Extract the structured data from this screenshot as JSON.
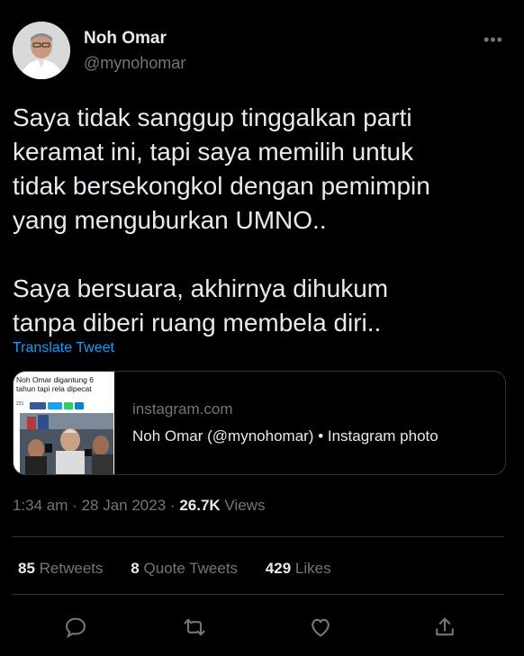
{
  "author": {
    "name": "Noh Omar",
    "handle": "@mynohomar"
  },
  "more_icon": "more-horizontal-icon",
  "tweet": {
    "text": "Saya tidak sanggup tinggalkan parti\nkeramat ini, tapi saya memilih untuk\ntidak bersekongkol dengan pemimpin\nyang menguburkan UMNO..\n\nSaya bersuara, akhirnya dihukum\ntanpa diberi ruang membela diri..",
    "translate_label": "Translate Tweet"
  },
  "link_card": {
    "thumb_headline": "Noh Omar digantung 6 tahun tapi rela dipecat",
    "thumb_count": "221",
    "domain": "instagram.com",
    "title": "Noh Omar (@mynohomar) • Instagram photo"
  },
  "meta": {
    "time": "1:34 am",
    "separator": "·",
    "date": "28 Jan 2023",
    "views_count": "26.7K",
    "views_label": "Views"
  },
  "stats": {
    "retweets_count": "85",
    "retweets_label": "Retweets",
    "quotes_count": "8",
    "quotes_label": "Quote Tweets",
    "likes_count": "429",
    "likes_label": "Likes"
  },
  "actions": [
    "reply-icon",
    "retweet-icon",
    "like-icon",
    "share-icon"
  ],
  "colors": {
    "background": "#000000",
    "text_primary": "#e7e9ea",
    "text_secondary": "#71767b",
    "link": "#1d9bf0",
    "border": "#2f3336"
  }
}
